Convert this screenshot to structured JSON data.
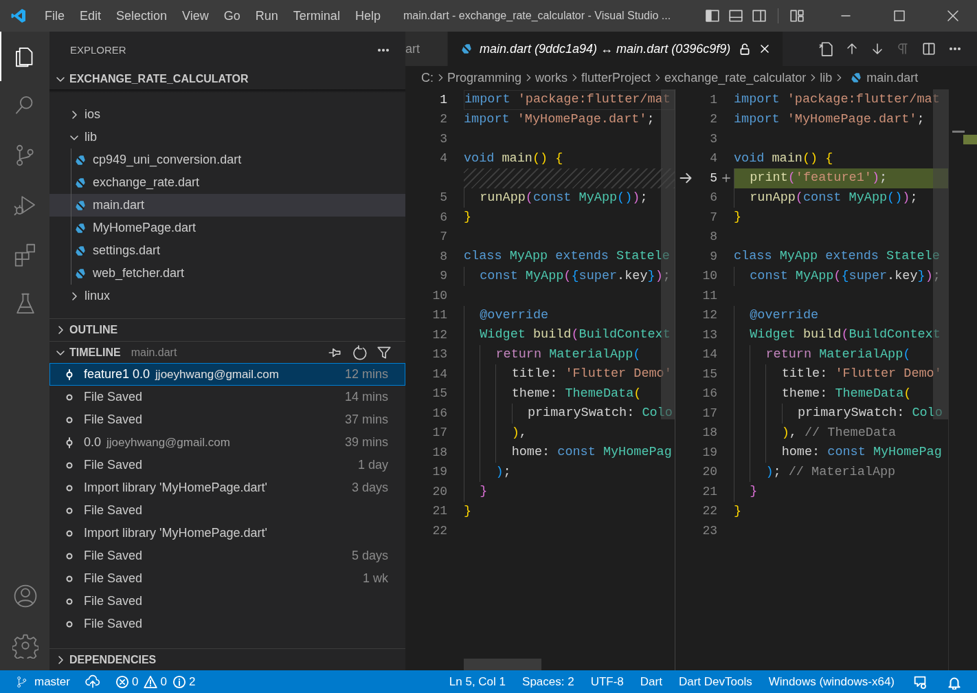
{
  "title_bar": {
    "menus": [
      "File",
      "Edit",
      "Selection",
      "View",
      "Go",
      "Run",
      "Terminal",
      "Help"
    ],
    "title": "main.dart - exchange_rate_calculator - Visual Studio ..."
  },
  "activity_bar": {
    "top": [
      {
        "kind": "explorer",
        "selected": true
      },
      {
        "kind": "search",
        "selected": false
      },
      {
        "kind": "source_control",
        "selected": false
      },
      {
        "kind": "run",
        "selected": false
      },
      {
        "kind": "extensions",
        "selected": false
      },
      {
        "kind": "testing",
        "selected": false
      }
    ],
    "bottom": [
      {
        "kind": "accounts",
        "selected": false
      },
      {
        "kind": "manage",
        "selected": false
      }
    ]
  },
  "sidebar": {
    "title": "EXPLORER",
    "sections": [
      {
        "kind": "tree",
        "title": "EXCHANGE_RATE_CALCULATOR",
        "expanded": true,
        "items": [
          {
            "kind": "folder",
            "label": "ios",
            "expanded": false,
            "selected": false
          },
          {
            "kind": "folder",
            "label": "lib",
            "expanded": true,
            "selected": false,
            "children": [
              {
                "kind": "file",
                "label": "cp949_uni_conversion.dart",
                "selected": false
              },
              {
                "kind": "file",
                "label": "exchange_rate.dart",
                "selected": false
              },
              {
                "kind": "file",
                "label": "main.dart",
                "selected": true
              },
              {
                "kind": "file",
                "label": "MyHomePage.dart",
                "selected": false
              },
              {
                "kind": "file",
                "label": "settings.dart",
                "selected": false
              },
              {
                "kind": "file",
                "label": "web_fetcher.dart",
                "selected": false
              }
            ]
          },
          {
            "kind": "folder",
            "label": "linux",
            "expanded": false,
            "selected": false
          }
        ]
      },
      {
        "kind": "outline",
        "title": "OUTLINE",
        "expanded": false
      },
      {
        "kind": "timeline",
        "title": "TIMELINE",
        "subtitle": "main.dart",
        "expanded": true,
        "items": [
          {
            "kind": "commit",
            "label": "feature1 0.0",
            "detail": "jjoeyhwang@gmail.com",
            "time": "12 mins",
            "selected": true
          },
          {
            "kind": "save",
            "label": "File Saved",
            "time": "14 mins",
            "selected": false
          },
          {
            "kind": "save",
            "label": "File Saved",
            "time": "37 mins",
            "selected": false
          },
          {
            "kind": "commit",
            "label": "0.0",
            "detail": "jjoeyhwang@gmail.com",
            "time": "39 mins",
            "selected": false
          },
          {
            "kind": "save",
            "label": "File Saved",
            "time": "1 day",
            "selected": false
          },
          {
            "kind": "save",
            "label": "Import library 'MyHomePage.dart'",
            "time": "3 days",
            "selected": false
          },
          {
            "kind": "save",
            "label": "File Saved",
            "selected": false
          },
          {
            "kind": "save",
            "label": "Import library 'MyHomePage.dart'",
            "selected": false
          },
          {
            "kind": "save",
            "label": "File Saved",
            "time": "5 days",
            "selected": false
          },
          {
            "kind": "save",
            "label": "File Saved",
            "time": "1 wk",
            "selected": false
          },
          {
            "kind": "save",
            "label": "File Saved",
            "selected": false
          },
          {
            "kind": "save",
            "label": "File Saved",
            "selected": false
          }
        ]
      },
      {
        "kind": "dependencies",
        "title": "DEPENDENCIES",
        "expanded": false
      }
    ]
  },
  "editor": {
    "tabs": [
      {
        "label": "art",
        "selected": false,
        "locked": false
      },
      {
        "label": "main.dart (9ddc1a94) ↔ main.dart (0396c9f9)",
        "selected": true,
        "locked": true
      }
    ],
    "breadcrumbs": [
      "C:",
      "Programming",
      "works",
      "flutterProject",
      "exchange_rate_calculator",
      "lib",
      "main.dart"
    ],
    "left": [
      {
        "kind": "normal",
        "n": "1",
        "current": true,
        "tokens": [
          {
            "kind": "keyword",
            "text": "import "
          },
          {
            "kind": "string",
            "text": "'package:flutter/mat"
          }
        ]
      },
      {
        "kind": "normal",
        "n": "2",
        "current": false,
        "tokens": [
          {
            "kind": "keyword",
            "text": "import "
          },
          {
            "kind": "string",
            "text": "'MyHomePage.dart'"
          },
          {
            "kind": "plain",
            "text": ";"
          }
        ]
      },
      {
        "kind": "normal",
        "n": "3",
        "current": false
      },
      {
        "kind": "normal",
        "n": "4",
        "current": false,
        "tokens": [
          {
            "kind": "keyword",
            "text": "void "
          },
          {
            "kind": "function",
            "text": "main"
          },
          {
            "kind": "bracket1",
            "text": "() {"
          }
        ]
      },
      {
        "kind": "spacer",
        "current": false
      },
      {
        "kind": "normal",
        "n": "5",
        "current": false,
        "tokens": [
          {
            "kind": "function",
            "text": "  runApp"
          },
          {
            "kind": "bracket2",
            "text": "("
          },
          {
            "kind": "keyword",
            "text": "const "
          },
          {
            "kind": "type",
            "text": "MyApp"
          },
          {
            "kind": "bracket3",
            "text": "()"
          },
          {
            "kind": "bracket2",
            "text": ")"
          },
          {
            "kind": "plain",
            "text": ";"
          }
        ]
      },
      {
        "kind": "normal",
        "n": "6",
        "current": false,
        "tokens": [
          {
            "kind": "bracket1",
            "text": "}"
          }
        ]
      },
      {
        "kind": "normal",
        "n": "7",
        "current": false
      },
      {
        "kind": "normal",
        "n": "8",
        "current": false,
        "tokens": [
          {
            "kind": "keyword",
            "text": "class "
          },
          {
            "kind": "type",
            "text": "MyApp "
          },
          {
            "kind": "keyword",
            "text": "extends "
          },
          {
            "kind": "type",
            "text": "Statele"
          }
        ]
      },
      {
        "kind": "normal",
        "n": "9",
        "current": false,
        "tokens": [
          {
            "kind": "keyword",
            "text": "  const "
          },
          {
            "kind": "type",
            "text": "MyApp"
          },
          {
            "kind": "bracket2",
            "text": "("
          },
          {
            "kind": "bracket3",
            "text": "{"
          },
          {
            "kind": "keyword",
            "text": "super"
          },
          {
            "kind": "plain",
            "text": ".key"
          },
          {
            "kind": "bracket3",
            "text": "}"
          },
          {
            "kind": "bracket2",
            "text": ")"
          },
          {
            "kind": "plain",
            "text": ";"
          }
        ]
      },
      {
        "kind": "normal",
        "n": "10",
        "current": false
      },
      {
        "kind": "normal",
        "n": "11",
        "current": false,
        "tokens": [
          {
            "kind": "keyword",
            "text": "  @override"
          }
        ]
      },
      {
        "kind": "normal",
        "n": "12",
        "current": false,
        "tokens": [
          {
            "kind": "type",
            "text": "  Widget "
          },
          {
            "kind": "function",
            "text": "build"
          },
          {
            "kind": "bracket2",
            "text": "("
          },
          {
            "kind": "type",
            "text": "BuildContext"
          }
        ]
      },
      {
        "kind": "normal",
        "n": "13",
        "current": false,
        "tokens": [
          {
            "kind": "control",
            "text": "    return "
          },
          {
            "kind": "type",
            "text": "MaterialApp"
          },
          {
            "kind": "bracket3",
            "text": "("
          }
        ]
      },
      {
        "kind": "normal",
        "n": "14",
        "current": false,
        "tokens": [
          {
            "kind": "plain",
            "text": "      title: "
          },
          {
            "kind": "string",
            "text": "'Flutter Demo'"
          }
        ]
      },
      {
        "kind": "normal",
        "n": "15",
        "current": false,
        "tokens": [
          {
            "kind": "plain",
            "text": "      theme: "
          },
          {
            "kind": "type",
            "text": "ThemeData"
          },
          {
            "kind": "bracket1",
            "text": "("
          }
        ]
      },
      {
        "kind": "normal",
        "n": "16",
        "current": false,
        "tokens": [
          {
            "kind": "plain",
            "text": "        primarySwatch: "
          },
          {
            "kind": "type",
            "text": "Colo"
          }
        ]
      },
      {
        "kind": "normal",
        "n": "17",
        "current": false,
        "tokens": [
          {
            "kind": "bracket1",
            "text": "      )"
          },
          {
            "kind": "plain",
            "text": ","
          }
        ]
      },
      {
        "kind": "normal",
        "n": "18",
        "current": false,
        "tokens": [
          {
            "kind": "plain",
            "text": "      home: "
          },
          {
            "kind": "keyword",
            "text": "const "
          },
          {
            "kind": "type",
            "text": "MyHomePag"
          }
        ]
      },
      {
        "kind": "normal",
        "n": "19",
        "current": false,
        "tokens": [
          {
            "kind": "bracket3",
            "text": "    )"
          },
          {
            "kind": "plain",
            "text": ";"
          }
        ]
      },
      {
        "kind": "normal",
        "n": "20",
        "current": false,
        "tokens": [
          {
            "kind": "bracket2",
            "text": "  }"
          }
        ]
      },
      {
        "kind": "normal",
        "n": "21",
        "current": false,
        "tokens": [
          {
            "kind": "bracket1",
            "text": "}"
          }
        ]
      },
      {
        "kind": "normal",
        "n": "22",
        "current": false
      }
    ],
    "right": [
      {
        "kind": "normal",
        "n": "1",
        "current": false,
        "tokens": [
          {
            "kind": "keyword",
            "text": "import "
          },
          {
            "kind": "string",
            "text": "'package:flutter/mat"
          }
        ]
      },
      {
        "kind": "normal",
        "n": "2",
        "current": false,
        "tokens": [
          {
            "kind": "keyword",
            "text": "import "
          },
          {
            "kind": "string",
            "text": "'MyHomePage.dart'"
          },
          {
            "kind": "plain",
            "text": ";"
          }
        ]
      },
      {
        "kind": "normal",
        "n": "3",
        "current": false
      },
      {
        "kind": "normal",
        "n": "4",
        "current": false,
        "tokens": [
          {
            "kind": "keyword",
            "text": "void "
          },
          {
            "kind": "function",
            "text": "main"
          },
          {
            "kind": "bracket1",
            "text": "() {"
          }
        ]
      },
      {
        "kind": "added",
        "n": "5",
        "current": true,
        "tokens": [
          {
            "kind": "function",
            "text": "  print"
          },
          {
            "kind": "bracket2",
            "text": "("
          },
          {
            "kind": "string",
            "text": "'feature1'"
          },
          {
            "kind": "bracket2",
            "text": ")"
          },
          {
            "kind": "plain",
            "text": ";"
          }
        ]
      },
      {
        "kind": "normal",
        "n": "6",
        "current": false,
        "tokens": [
          {
            "kind": "function",
            "text": "  runApp"
          },
          {
            "kind": "bracket2",
            "text": "("
          },
          {
            "kind": "keyword",
            "text": "const "
          },
          {
            "kind": "type",
            "text": "MyApp"
          },
          {
            "kind": "bracket3",
            "text": "()"
          },
          {
            "kind": "bracket2",
            "text": ")"
          },
          {
            "kind": "plain",
            "text": ";"
          }
        ]
      },
      {
        "kind": "normal",
        "n": "7",
        "current": false,
        "tokens": [
          {
            "kind": "bracket1",
            "text": "}"
          }
        ]
      },
      {
        "kind": "normal",
        "n": "8",
        "current": false
      },
      {
        "kind": "normal",
        "n": "9",
        "current": false,
        "tokens": [
          {
            "kind": "keyword",
            "text": "class "
          },
          {
            "kind": "type",
            "text": "MyApp "
          },
          {
            "kind": "keyword",
            "text": "extends "
          },
          {
            "kind": "type",
            "text": "Statele"
          }
        ]
      },
      {
        "kind": "normal",
        "n": "10",
        "current": false,
        "tokens": [
          {
            "kind": "keyword",
            "text": "  const "
          },
          {
            "kind": "type",
            "text": "MyApp"
          },
          {
            "kind": "bracket2",
            "text": "("
          },
          {
            "kind": "bracket3",
            "text": "{"
          },
          {
            "kind": "keyword",
            "text": "super"
          },
          {
            "kind": "plain",
            "text": ".key"
          },
          {
            "kind": "bracket3",
            "text": "}"
          },
          {
            "kind": "bracket2",
            "text": ")"
          },
          {
            "kind": "plain",
            "text": ";"
          }
        ]
      },
      {
        "kind": "normal",
        "n": "11",
        "current": false
      },
      {
        "kind": "normal",
        "n": "12",
        "current": false,
        "tokens": [
          {
            "kind": "keyword",
            "text": "  @override"
          }
        ]
      },
      {
        "kind": "normal",
        "n": "13",
        "current": false,
        "tokens": [
          {
            "kind": "type",
            "text": "  Widget "
          },
          {
            "kind": "function",
            "text": "build"
          },
          {
            "kind": "bracket2",
            "text": "("
          },
          {
            "kind": "type",
            "text": "BuildContext"
          }
        ]
      },
      {
        "kind": "normal",
        "n": "14",
        "current": false,
        "tokens": [
          {
            "kind": "control",
            "text": "    return "
          },
          {
            "kind": "type",
            "text": "MaterialApp"
          },
          {
            "kind": "bracket3",
            "text": "("
          }
        ]
      },
      {
        "kind": "normal",
        "n": "15",
        "current": false,
        "tokens": [
          {
            "kind": "plain",
            "text": "      title: "
          },
          {
            "kind": "string",
            "text": "'Flutter Demo'"
          }
        ]
      },
      {
        "kind": "normal",
        "n": "16",
        "current": false,
        "tokens": [
          {
            "kind": "plain",
            "text": "      theme: "
          },
          {
            "kind": "type",
            "text": "ThemeData"
          },
          {
            "kind": "bracket1",
            "text": "("
          }
        ]
      },
      {
        "kind": "normal",
        "n": "17",
        "current": false,
        "tokens": [
          {
            "kind": "plain",
            "text": "        primarySwatch: "
          },
          {
            "kind": "type",
            "text": "Colo"
          }
        ]
      },
      {
        "kind": "normal",
        "n": "18",
        "current": false,
        "tokens": [
          {
            "kind": "bracket1",
            "text": "      )"
          },
          {
            "kind": "plain",
            "text": ", "
          },
          {
            "kind": "comment",
            "text": "// ThemeData"
          }
        ]
      },
      {
        "kind": "normal",
        "n": "19",
        "current": false,
        "tokens": [
          {
            "kind": "plain",
            "text": "      home: "
          },
          {
            "kind": "keyword",
            "text": "const "
          },
          {
            "kind": "type",
            "text": "MyHomePag"
          }
        ]
      },
      {
        "kind": "normal",
        "n": "20",
        "current": false,
        "tokens": [
          {
            "kind": "bracket3",
            "text": "    )"
          },
          {
            "kind": "plain",
            "text": "; "
          },
          {
            "kind": "comment",
            "text": "// MaterialApp"
          }
        ]
      },
      {
        "kind": "normal",
        "n": "21",
        "current": false,
        "tokens": [
          {
            "kind": "bracket2",
            "text": "  }"
          }
        ]
      },
      {
        "kind": "normal",
        "n": "22",
        "current": false,
        "tokens": [
          {
            "kind": "bracket1",
            "text": "}"
          }
        ]
      },
      {
        "kind": "normal",
        "n": "23",
        "current": false
      }
    ]
  },
  "status_bar": {
    "left": [
      {
        "kind": "branch",
        "text": "master"
      },
      {
        "kind": "sync"
      },
      {
        "kind": "problems",
        "errors": "0",
        "warnings": "0",
        "infos": "2"
      }
    ],
    "right": [
      {
        "kind": "text",
        "text": "Ln 5, Col 1"
      },
      {
        "kind": "text",
        "text": "Spaces: 2"
      },
      {
        "kind": "text",
        "text": "UTF-8"
      },
      {
        "kind": "text",
        "text": "Dart"
      },
      {
        "kind": "text",
        "text": "Dart DevTools"
      },
      {
        "kind": "text",
        "text": "Windows (windows-x64)"
      },
      {
        "kind": "feedback"
      },
      {
        "kind": "notifications"
      }
    ]
  }
}
